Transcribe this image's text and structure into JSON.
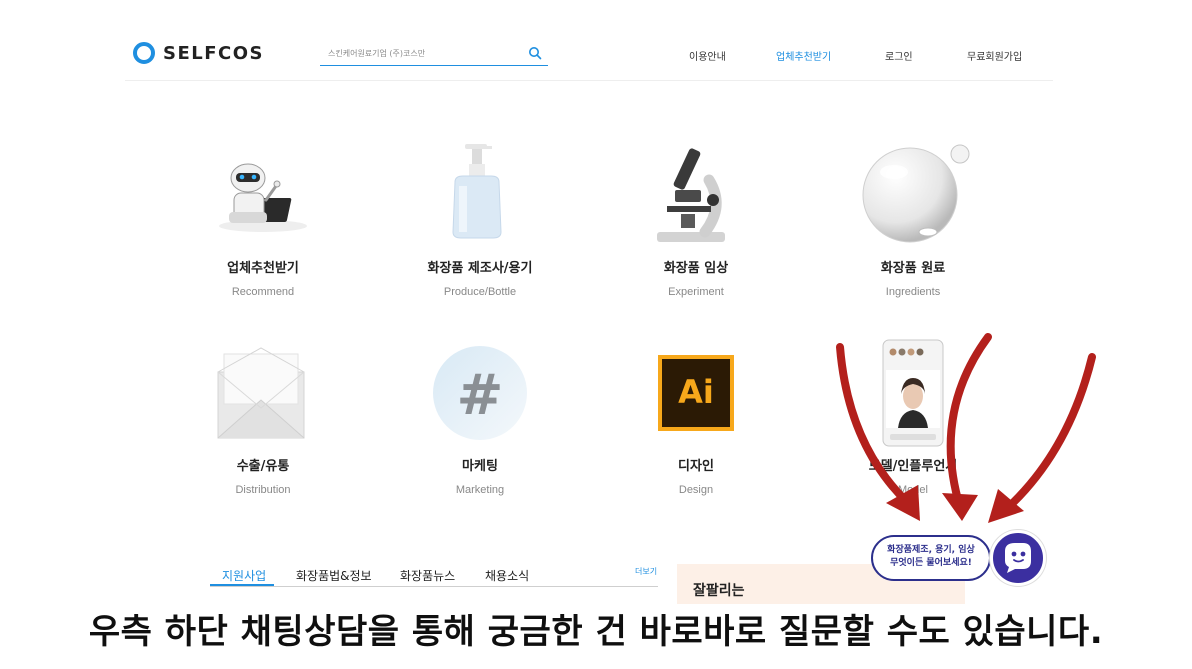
{
  "header": {
    "logo_text": "SELFCOS",
    "search_placeholder": "스킨케어원료기업 (주)코스만",
    "nav": [
      {
        "label": "이용안내",
        "active": false
      },
      {
        "label": "업체추천받기",
        "active": true
      },
      {
        "label": "로그인",
        "active": false
      },
      {
        "label": "무료회원가입",
        "active": false
      }
    ]
  },
  "categories": [
    {
      "title": "업체추천받기",
      "subtitle": "Recommend",
      "icon": "robot-icon"
    },
    {
      "title": "화장품 제조사/용기",
      "subtitle": "Produce/Bottle",
      "icon": "pump-bottle-icon"
    },
    {
      "title": "화장품 임상",
      "subtitle": "Experiment",
      "icon": "microscope-icon"
    },
    {
      "title": "화장품 원료",
      "subtitle": "Ingredients",
      "icon": "bubble-icon"
    },
    {
      "title": "수출/유통",
      "subtitle": "Distribution",
      "icon": "envelope-icon"
    },
    {
      "title": "마케팅",
      "subtitle": "Marketing",
      "icon": "hashtag-icon"
    },
    {
      "title": "디자인",
      "subtitle": "Design",
      "icon": "illustrator-icon",
      "icon_text": "Ai"
    },
    {
      "title": "모델/인플루언서",
      "subtitle": "Model",
      "icon": "phone-model-icon"
    }
  ],
  "tabs": {
    "items": [
      "지원사업",
      "화장품법&정보",
      "화장품뉴스",
      "채용소식"
    ],
    "active_index": 0,
    "more_label": "더보기"
  },
  "side_box": {
    "title": "잘팔리는"
  },
  "chat": {
    "line1": "화장품제조, 용기, 임상",
    "line2": "무엇이든 물어보세요!"
  },
  "caption": "우측 하단 채팅상담을 통해 궁금한 건 바로바로 질문할 수도 있습니다.",
  "colors": {
    "accent": "#1f8fe0",
    "chat": "#2c2f8c",
    "arrow": "#b3201c",
    "side_box": "#fdf0e7"
  }
}
